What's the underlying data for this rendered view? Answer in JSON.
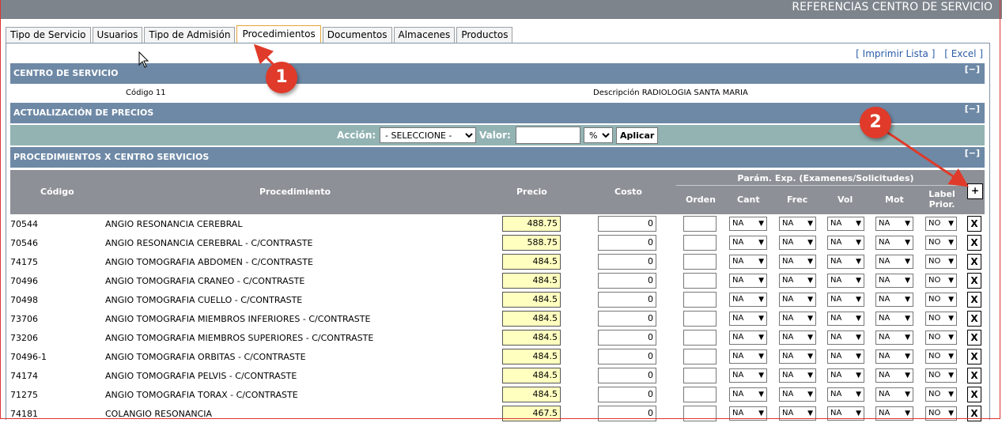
{
  "window": {
    "title": "REFERENCIAS CENTRO DE SERVICIO"
  },
  "tabs": [
    {
      "label": "Tipo de Servicio",
      "active": false
    },
    {
      "label": "Usuarios",
      "active": false
    },
    {
      "label": "Tipo de Admisión",
      "active": false
    },
    {
      "label": "Procedimientos",
      "active": true
    },
    {
      "label": "Documentos",
      "active": false
    },
    {
      "label": "Almacenes",
      "active": false
    },
    {
      "label": "Productos",
      "active": false
    }
  ],
  "links": {
    "print": "[ Imprimir Lista ]",
    "excel": "[ Excel ]"
  },
  "sections": {
    "centro": {
      "title": "CENTRO DE SERVICIO",
      "collapse": "[−]"
    },
    "precios": {
      "title": "ACTUALIZACIÓN DE PRECIOS",
      "collapse": "[−]"
    },
    "procs": {
      "title": "PROCEDIMIENTOS X CENTRO SERVICIOS",
      "collapse": "[−]"
    }
  },
  "centro": {
    "codigo": "Código 11",
    "descripcion": "Descripción RADIOLOGIA SANTA MARIA"
  },
  "actualizacion": {
    "accion_label": "Acción:",
    "accion_value": "- SELECCIONE -",
    "valor_label": "Valor:",
    "valor_value": "",
    "unit_value": "%",
    "apply_label": "Aplicar"
  },
  "table": {
    "headers": {
      "codigo": "Código",
      "procedimiento": "Procedimiento",
      "precio": "Precio",
      "costo": "Costo",
      "params_group": "Parám. Exp. (Examenes/Solicitudes)",
      "orden": "Orden",
      "cant": "Cant",
      "frec": "Frec",
      "vol": "Vol",
      "mot": "Mot",
      "label_prior": "Label Prior.",
      "add": "+"
    },
    "rows": [
      {
        "codigo": "70544",
        "procedimiento": "ANGIO RESONANCIA CEREBRAL",
        "precio": "488.75",
        "costo": "0"
      },
      {
        "codigo": "70546",
        "procedimiento": "ANGIO RESONANCIA CEREBRAL - C/CONTRASTE",
        "precio": "588.75",
        "costo": "0"
      },
      {
        "codigo": "74175",
        "procedimiento": "ANGIO TOMOGRAFIA ABDOMEN - C/CONTRASTE",
        "precio": "484.5",
        "costo": "0"
      },
      {
        "codigo": "70496",
        "procedimiento": "ANGIO TOMOGRAFIA CRANEO - C/CONTRASTE",
        "precio": "484.5",
        "costo": "0"
      },
      {
        "codigo": "70498",
        "procedimiento": "ANGIO TOMOGRAFIA CUELLO - C/CONTRASTE",
        "precio": "484.5",
        "costo": "0"
      },
      {
        "codigo": "73706",
        "procedimiento": "ANGIO TOMOGRAFIA MIEMBROS INFERIORES - C/CONTRASTE",
        "precio": "484.5",
        "costo": "0"
      },
      {
        "codigo": "73206",
        "procedimiento": "ANGIO TOMOGRAFIA MIEMBROS SUPERIORES - C/CONTRASTE",
        "precio": "484.5",
        "costo": "0"
      },
      {
        "codigo": "70496-1",
        "procedimiento": "ANGIO TOMOGRAFIA ORBITAS - C/CONTRASTE",
        "precio": "484.5",
        "costo": "0"
      },
      {
        "codigo": "74174",
        "procedimiento": "ANGIO TOMOGRAFIA PELVIS - C/CONTRASTE",
        "precio": "484.5",
        "costo": "0"
      },
      {
        "codigo": "71275",
        "procedimiento": "ANGIO TOMOGRAFIA TORAX - C/CONTRASTE",
        "precio": "484.5",
        "costo": "0"
      },
      {
        "codigo": "74181",
        "procedimiento": "COLANGIO RESONANCIA",
        "precio": "467.5",
        "costo": "0"
      }
    ],
    "select_default": "NA",
    "label_prior_default": "NO",
    "delete_label": "X"
  },
  "annotations": {
    "badge1": "1",
    "badge2": "2"
  },
  "colors": {
    "section": "#6e89a6",
    "action_bar": "#93b3b3",
    "table_header": "#8d9096",
    "price_bg": "#ffffc0",
    "badge": "#e03a2a"
  }
}
